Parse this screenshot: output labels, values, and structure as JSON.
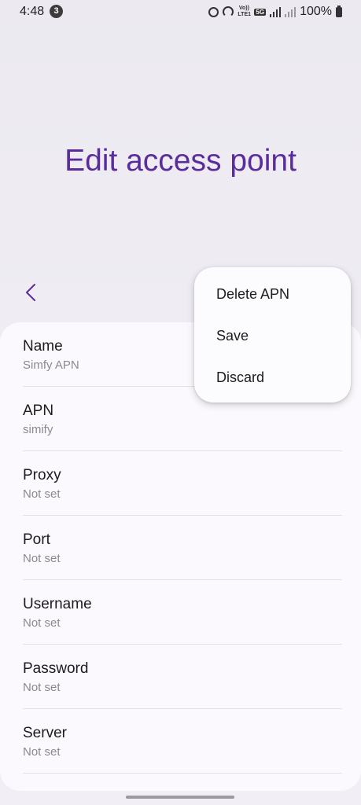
{
  "status_bar": {
    "time": "4:48",
    "notification_count": "3",
    "network_volte": "Vo)) LTE1",
    "network_5g": "5G",
    "battery": "100%"
  },
  "header": {
    "title": "Edit access point"
  },
  "menu": {
    "items": [
      {
        "label": "Delete APN"
      },
      {
        "label": "Save"
      },
      {
        "label": "Discard"
      }
    ]
  },
  "settings": {
    "items": [
      {
        "label": "Name",
        "value": "Simfy APN"
      },
      {
        "label": "APN",
        "value": "simify"
      },
      {
        "label": "Proxy",
        "value": "Not set"
      },
      {
        "label": "Port",
        "value": "Not set"
      },
      {
        "label": "Username",
        "value": "Not set"
      },
      {
        "label": "Password",
        "value": "Not set"
      },
      {
        "label": "Server",
        "value": "Not set"
      }
    ]
  },
  "colors": {
    "accent": "#5a2d9c",
    "background": "#efedf3",
    "card": "#fbf9fd"
  }
}
